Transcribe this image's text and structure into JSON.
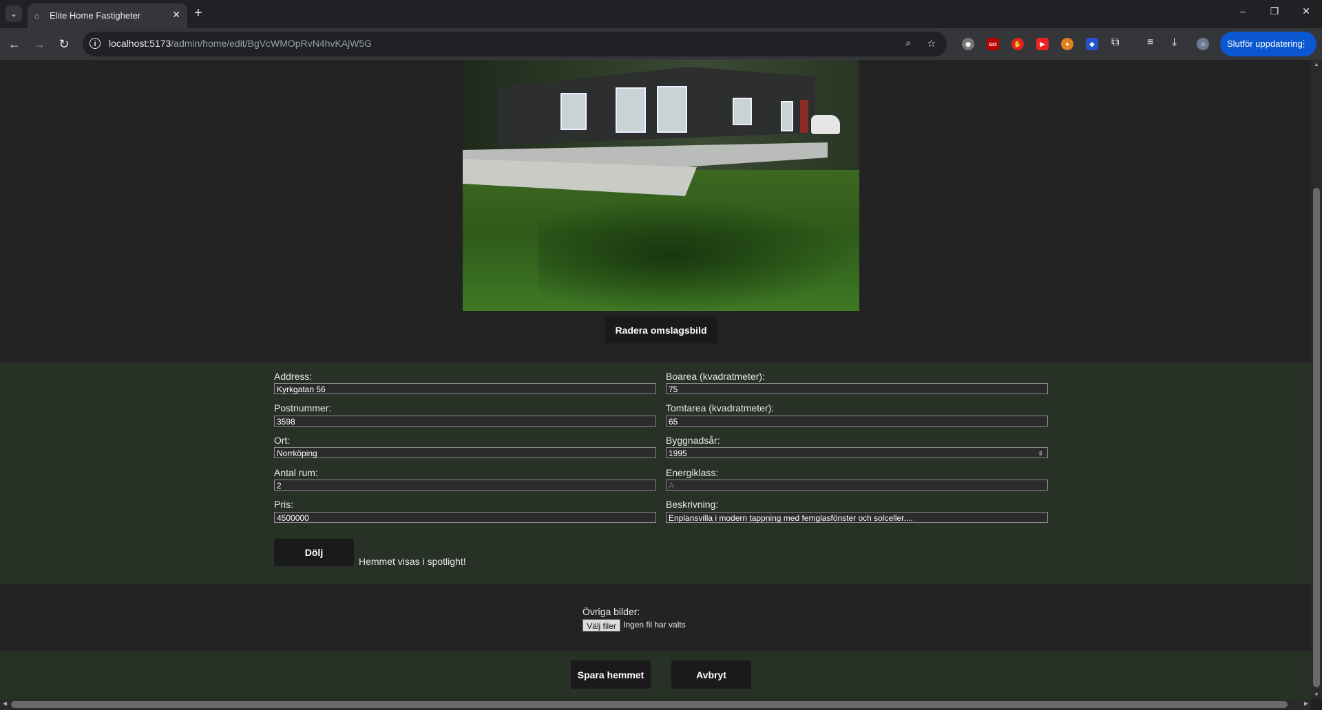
{
  "browser": {
    "tab_title": "Elite Home Fastigheter",
    "url_host": "localhost:5173",
    "url_path": "/admin/home/edit/BgVcWMOpRvN4hvKAjW5G",
    "update_label": "Slutför uppdatering",
    "tab_menu_icon": "chevron-down",
    "new_tab_icon": "plus"
  },
  "cover": {
    "delete_label": "Radera omslagsbild"
  },
  "form": {
    "address_label": "Address:",
    "address_value": "Kyrkgatan 56",
    "postnummer_label": "Postnummer:",
    "postnummer_value": "3598",
    "ort_label": "Ort:",
    "ort_value": "Norrköping",
    "antal_rum_label": "Antal rum:",
    "antal_rum_value": "2",
    "pris_label": "Pris:",
    "pris_value": "4500000",
    "boarea_label": "Boarea (kvadratmeter):",
    "boarea_value": "75",
    "tomtarea_label": "Tomtarea (kvadratmeter):",
    "tomtarea_value": "65",
    "byggnadsar_label": "Byggnadsår:",
    "byggnadsar_value": "1995",
    "energiklass_label": "Energiklass:",
    "energiklass_placeholder": "A",
    "beskrivning_label": "Beskrivning:",
    "beskrivning_value": "Enplansvilla i modern tappning med femglasfönster och solceller....",
    "hide_label": "Dölj",
    "spotlight_text": "Hemmet visas i spotlight!"
  },
  "files": {
    "label": "Övriga bilder:",
    "choose_label": "Välj filer",
    "none_text": "Ingen fil har valts"
  },
  "actions": {
    "save_label": "Spara hemmet",
    "cancel_label": "Avbryt"
  }
}
